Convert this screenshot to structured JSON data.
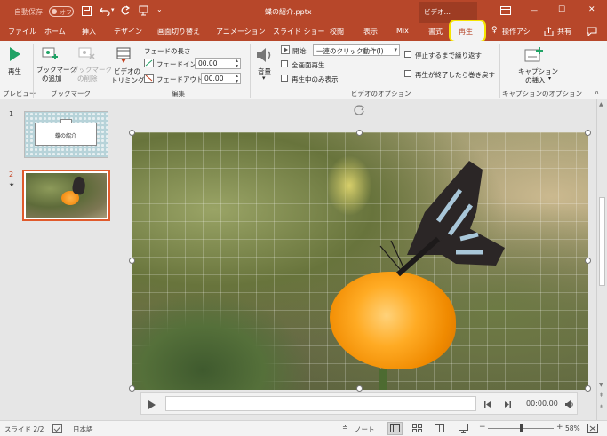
{
  "titlebar": {
    "autosave_label": "自動保存",
    "autosave_state": "オフ",
    "filename": "蝶の紹介.pptx",
    "context_tab_group": "ビデオ…",
    "minimize": "—",
    "maximize": "☐",
    "close": "✕"
  },
  "tabs": [
    "ファイル",
    "ホーム",
    "挿入",
    "デザイン",
    "画面切り替え",
    "アニメーション",
    "スライド ショー",
    "校閲",
    "表示",
    "Mix",
    "書式",
    "再生"
  ],
  "active_tab": "再生",
  "tell_me": "操作アシ",
  "share": "共有",
  "ribbon": {
    "preview": {
      "play": "再生",
      "group": "プレビュー"
    },
    "bookmarks": {
      "add_line1": "ブックマーク",
      "add_line2": "の追加",
      "remove_line1": "ブックマーク",
      "remove_line2": "の削除",
      "group": "ブックマーク"
    },
    "editing": {
      "trim_line1": "ビデオの",
      "trim_line2": "トリミング",
      "fade_title": "フェードの長さ",
      "fade_in_label": "フェードイン:",
      "fade_in_value": "00.00",
      "fade_out_label": "フェードアウト:",
      "fade_out_value": "00.00",
      "group": "編集"
    },
    "video_options": {
      "volume": "音量",
      "start_label": "開始:",
      "start_value": "一連のクリック動作(I)",
      "fullscreen": "全画面再生",
      "hide_not_playing": "再生中のみ表示",
      "loop": "停止するまで繰り返す",
      "rewind": "再生が終了したら巻き戻す",
      "group": "ビデオのオプション"
    },
    "captions": {
      "insert_line1": "キャプション",
      "insert_line2": "の挿入",
      "group": "キャプションのオプション"
    }
  },
  "thumbnails": [
    {
      "number": "1",
      "title": "蝶の紹介"
    },
    {
      "number": "2",
      "star": "★"
    }
  ],
  "player": {
    "time": "00:00.00"
  },
  "status": {
    "slide": "スライド 2/2",
    "language": "日本語",
    "notes": "ノート",
    "zoom": "58%",
    "zoom_fraction": 0.5
  },
  "colors": {
    "accent": "#b7472a",
    "highlight": "#f5e400",
    "selected_border": "#e05a2c"
  }
}
